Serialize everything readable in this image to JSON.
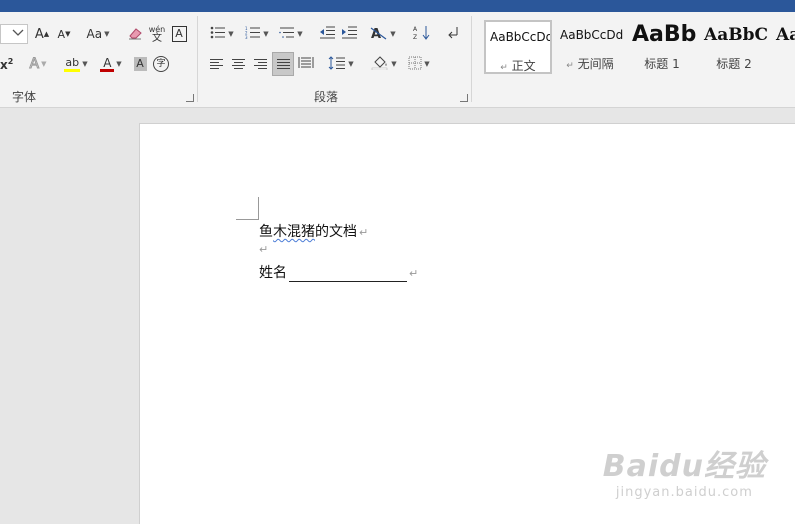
{
  "colors": {
    "titlebar": "#2b579a",
    "font_color_underline": "#c00000",
    "highlight_underline": "#ffff00"
  },
  "title_tabs": [],
  "font_group": {
    "label": "字体",
    "font_size_value": "",
    "buttons": {
      "grow_font": "A",
      "shrink_font": "A",
      "change_case": "Aa",
      "clear_format_icon": "eraser-icon",
      "pinyin_guide": "wén\n文",
      "char_border": "A",
      "superscript": "x²",
      "text_effects": "A",
      "highlight": "ab",
      "font_color": "A",
      "char_shading": "A",
      "enclose_char": "字"
    }
  },
  "paragraph_group": {
    "label": "段落"
  },
  "styles_group": {
    "items": [
      {
        "sample": "AaBbCcDd",
        "name": "正文",
        "prefix": "↵"
      },
      {
        "sample": "AaBbCcDd",
        "name": "无间隔",
        "prefix": "↵"
      },
      {
        "sample": "AaBb",
        "name": "标题 1"
      },
      {
        "sample": "AaBbC",
        "name": "标题 2"
      },
      {
        "sample": "Aa",
        "name": ""
      }
    ]
  },
  "document": {
    "line1": "鱼木混猪的文档",
    "line2_empty_mark": "↵",
    "line3_label": "姓名",
    "paragraph_mark": "↵"
  },
  "watermark": {
    "brand": "Baidu经验",
    "url": "jingyan.baidu.com"
  }
}
